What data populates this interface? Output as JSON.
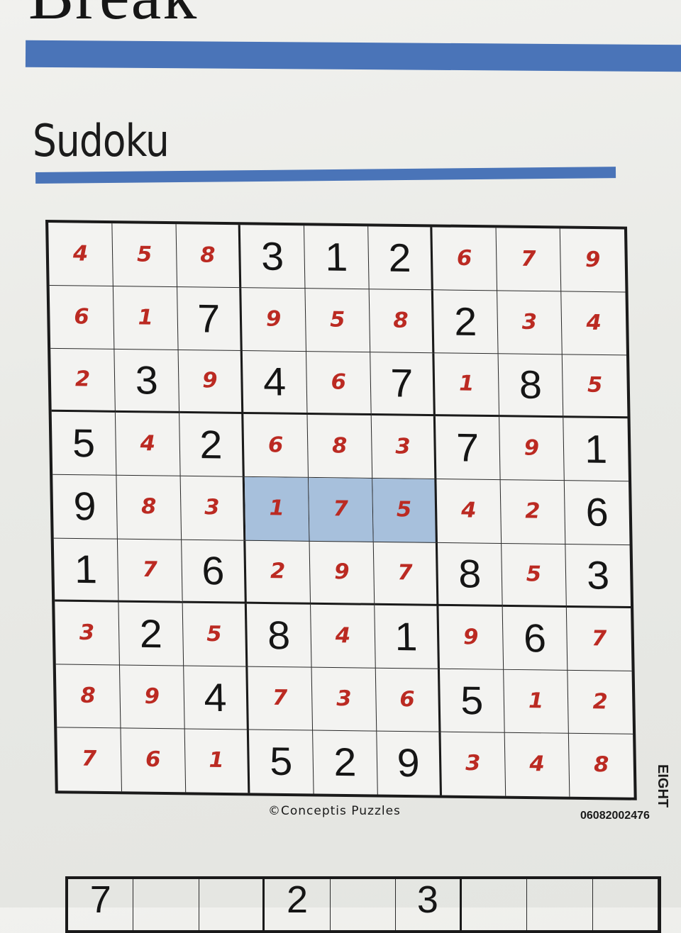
{
  "masthead": {
    "text": "Break"
  },
  "section": {
    "title": "Sudoku"
  },
  "credit": "©Conceptis Puzzles",
  "puzzle_id": "06082002476",
  "side_text": "EIGHT",
  "highlight": {
    "color": "#a7c0dc",
    "cells": [
      [
        4,
        3
      ],
      [
        4,
        4
      ],
      [
        4,
        5
      ]
    ]
  },
  "colors": {
    "printed": "#151515",
    "handwritten": "#bb2a22",
    "rule": "#4a74b8"
  },
  "sudoku": {
    "values": [
      [
        "4",
        "5",
        "8",
        "3",
        "1",
        "2",
        "6",
        "7",
        "9"
      ],
      [
        "6",
        "1",
        "7",
        "9",
        "5",
        "8",
        "2",
        "3",
        "4"
      ],
      [
        "2",
        "3",
        "9",
        "4",
        "6",
        "7",
        "1",
        "8",
        "5"
      ],
      [
        "5",
        "4",
        "2",
        "6",
        "8",
        "3",
        "7",
        "9",
        "1"
      ],
      [
        "9",
        "8",
        "3",
        "1",
        "7",
        "5",
        "4",
        "2",
        "6"
      ],
      [
        "1",
        "7",
        "6",
        "2",
        "9",
        "7",
        "8",
        "5",
        "3"
      ],
      [
        "3",
        "2",
        "5",
        "8",
        "4",
        "1",
        "9",
        "6",
        "7"
      ],
      [
        "8",
        "9",
        "4",
        "7",
        "3",
        "6",
        "5",
        "1",
        "2"
      ],
      [
        "7",
        "6",
        "1",
        "5",
        "2",
        "9",
        "3",
        "4",
        "8"
      ]
    ],
    "given": [
      [
        false,
        false,
        false,
        true,
        true,
        true,
        false,
        false,
        false
      ],
      [
        false,
        false,
        true,
        false,
        false,
        false,
        true,
        false,
        false
      ],
      [
        false,
        true,
        false,
        true,
        false,
        true,
        false,
        true,
        false
      ],
      [
        true,
        false,
        true,
        false,
        false,
        false,
        true,
        false,
        true
      ],
      [
        true,
        false,
        false,
        false,
        false,
        false,
        false,
        false,
        true
      ],
      [
        true,
        false,
        true,
        false,
        false,
        false,
        true,
        false,
        true
      ],
      [
        false,
        true,
        false,
        true,
        false,
        true,
        false,
        true,
        false
      ],
      [
        false,
        false,
        true,
        false,
        false,
        false,
        true,
        false,
        false
      ],
      [
        false,
        false,
        false,
        true,
        true,
        true,
        false,
        false,
        false
      ]
    ]
  },
  "next_puzzle_row": [
    "7",
    "",
    "",
    "2",
    "",
    "3",
    "",
    "",
    ""
  ]
}
